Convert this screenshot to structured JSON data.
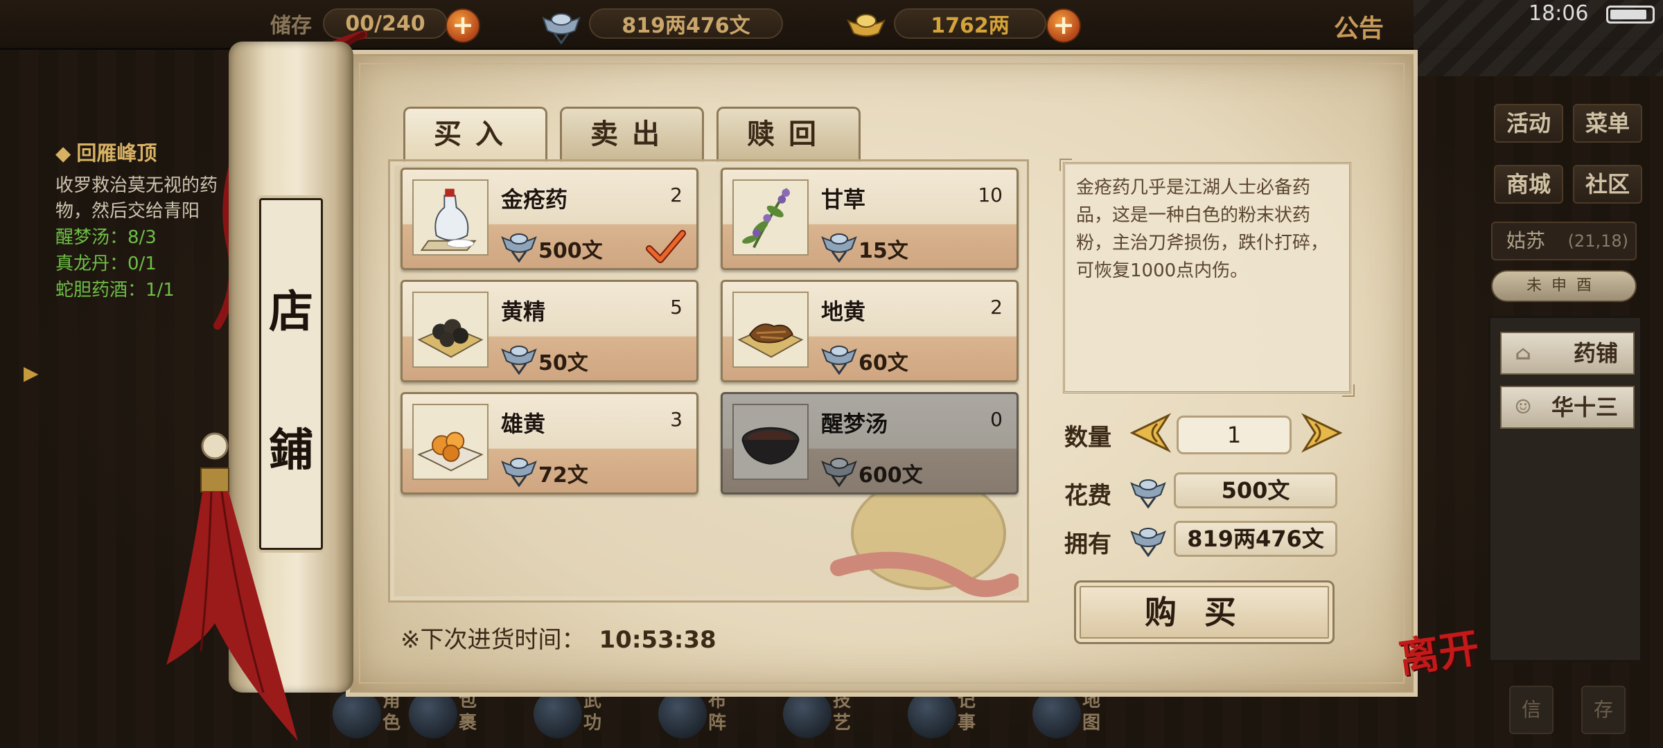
{
  "topbar": {
    "bag_label": "储存",
    "bag_count": "00/240",
    "silver": "819两476文",
    "gold": "1762两",
    "plus": "+",
    "announce": "公告",
    "time": "18:06"
  },
  "quest": {
    "title": "回雁峰顶",
    "desc": "收罗救治莫无视的药物，然后交给青阳",
    "items": [
      "醒梦汤：8/3",
      "真龙丹：0/1",
      "蛇胆药酒：1/1"
    ]
  },
  "right_menu": {
    "activity": "活动",
    "menu": "菜单",
    "mall": "商城",
    "community": "社区",
    "location": "姑苏",
    "coords": "(21,18)",
    "compass": "未申酉",
    "npc_shop": "药铺",
    "npc_person": "华十三",
    "bottom_left": "信",
    "bottom_right": "存"
  },
  "scroll": {
    "title_top": "店",
    "title_bottom": "鋪"
  },
  "tabs": [
    {
      "label": "买入",
      "active": true
    },
    {
      "label": "卖出",
      "active": false
    },
    {
      "label": "赎回",
      "active": false
    }
  ],
  "items": [
    {
      "name": "金疮药",
      "count": "2",
      "price": "500文",
      "selected": true,
      "disabled": false,
      "icon": "medicine-bottle-icon"
    },
    {
      "name": "甘草",
      "count": "10",
      "price": "15文",
      "selected": false,
      "disabled": false,
      "icon": "herb-icon"
    },
    {
      "name": "黄精",
      "count": "5",
      "price": "50文",
      "selected": false,
      "disabled": false,
      "icon": "huangjing-icon"
    },
    {
      "name": "地黄",
      "count": "2",
      "price": "60文",
      "selected": false,
      "disabled": false,
      "icon": "dihuang-icon"
    },
    {
      "name": "雄黄",
      "count": "3",
      "price": "72文",
      "selected": false,
      "disabled": false,
      "icon": "realgar-icon"
    },
    {
      "name": "醒梦汤",
      "count": "0",
      "price": "600文",
      "selected": false,
      "disabled": true,
      "icon": "soup-bowl-icon"
    }
  ],
  "restock": {
    "label": "※下次进货时间：",
    "time": "10:53:38"
  },
  "detail": {
    "description": "金疮药几乎是江湖人士必备药品，这是一种白色的粉末状药粉，主治刀斧损伤，跌仆打碎，可恢复1000点内伤。",
    "qty_label": "数量",
    "qty": "1",
    "cost_label": "花费",
    "cost": "500文",
    "own_label": "拥有",
    "own": "819两476文",
    "buy": "购买"
  },
  "leave": "离开",
  "bottom_nav": [
    {
      "label": "角色",
      "icon": "character-icon"
    },
    {
      "label": "包裹",
      "icon": "bag-icon"
    },
    {
      "label": "武功",
      "icon": "martial-arts-icon"
    },
    {
      "label": "布阵",
      "icon": "formation-icon"
    },
    {
      "label": "技艺",
      "icon": "skills-icon"
    },
    {
      "label": "记事",
      "icon": "journal-icon"
    },
    {
      "label": "地图",
      "icon": "map-icon"
    }
  ],
  "colors": {
    "paper": "#e6d8bb",
    "ink": "#2a1c10",
    "quest_green": "#6fbf47",
    "accent_orange": "#e07a2a",
    "leave_red": "#c21919"
  }
}
